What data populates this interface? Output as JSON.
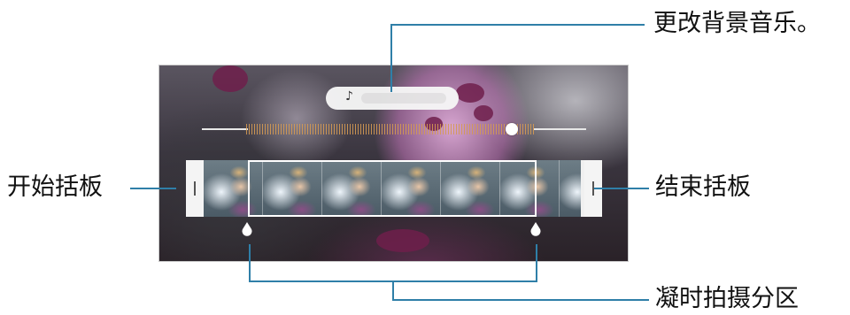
{
  "editor": {
    "music_icon": "music-note-icon",
    "music_note_glyph": "♪"
  },
  "callouts": {
    "background_music": "更改背景音乐。",
    "start_handle": "开始括板",
    "end_handle": "结束括板",
    "hyperlapse_section": "凝时拍摄分区"
  },
  "colors": {
    "callout_line": "#2f7fa8",
    "waveform": "#d59a52"
  }
}
